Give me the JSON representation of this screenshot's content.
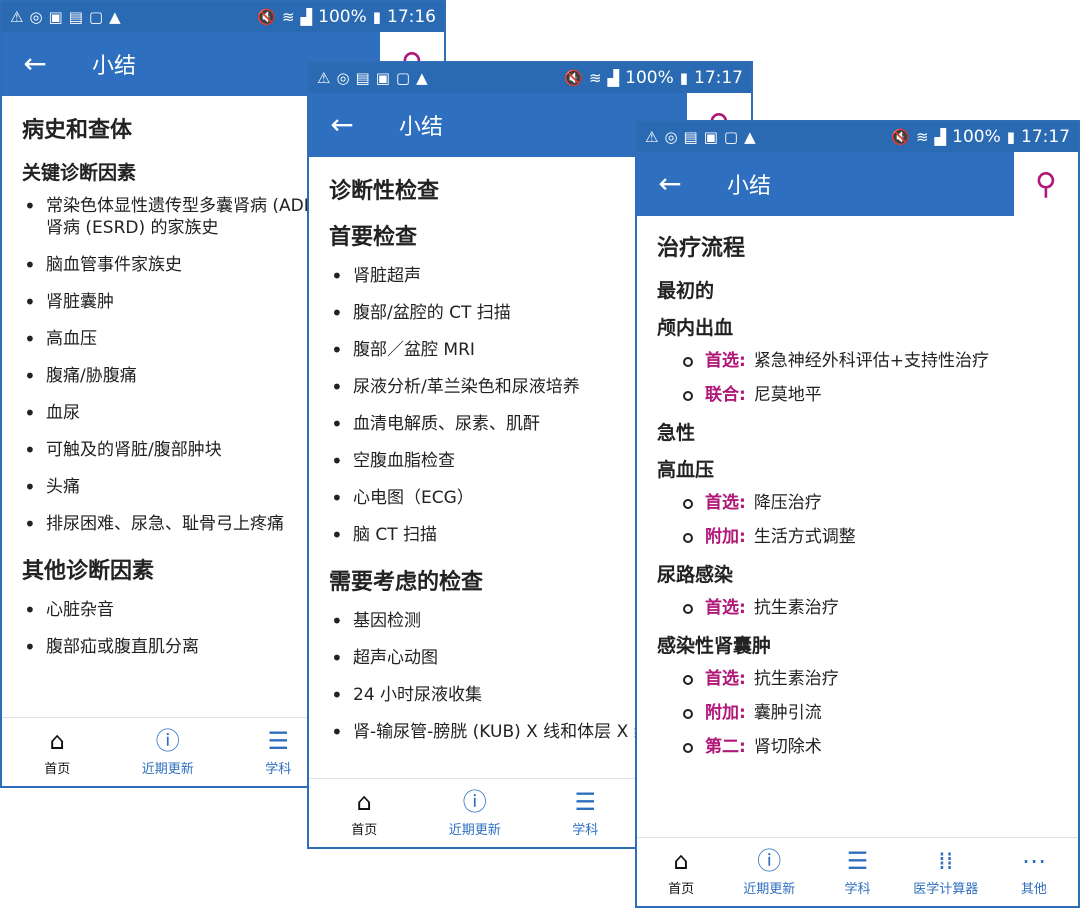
{
  "status": {
    "time1": "17:16",
    "time2": "17:17",
    "time3": "17:17",
    "battery": "100%"
  },
  "appbar": {
    "title": "小结"
  },
  "nav": [
    {
      "label": "首页"
    },
    {
      "label": "近期更新"
    },
    {
      "label": "学科"
    },
    {
      "label": "医学计算器"
    },
    {
      "label": "其他"
    }
  ],
  "screen1": {
    "heading": "病史和查体",
    "sub1": "关键诊断因素",
    "items1": [
      "常染色体显性遗传型多囊肾病 (ADPKD) 或终末期肾病 (ESRD) 的家族史",
      "脑血管事件家族史",
      "肾脏囊肿",
      "高血压",
      "腹痛/胁腹痛",
      "血尿",
      "可触及的肾脏/腹部肿块",
      "头痛",
      "排尿困难、尿急、耻骨弓上疼痛"
    ],
    "sub2": "其他诊断因素",
    "items2": [
      "心脏杂音",
      "腹部疝或腹直肌分离"
    ]
  },
  "screen2": {
    "heading": "诊断性检查",
    "sub1": "首要检查",
    "items1": [
      "肾脏超声",
      "腹部/盆腔的 CT 扫描",
      "腹部／盆腔 MRI",
      "尿液分析/革兰染色和尿液培养",
      "血清电解质、尿素、肌酐",
      "空腹血脂检查",
      "心电图（ECG）",
      "脑 CT 扫描"
    ],
    "sub2": "需要考虑的检查",
    "items2": [
      "基因检测",
      "超声心动图",
      "24 小时尿液收集",
      "肾-输尿管-膀胱 (KUB) X 线和体层 X 线摄影"
    ]
  },
  "screen3": {
    "heading": "治疗流程",
    "s1": "最初的",
    "s1a": "颅内出血",
    "s1a_items": [
      {
        "tag": "首选:",
        "text": "紧急神经外科评估+支持性治疗"
      },
      {
        "tag": "联合:",
        "text": "尼莫地平"
      }
    ],
    "s2": "急性",
    "s2a": "高血压",
    "s2a_items": [
      {
        "tag": "首选:",
        "text": "降压治疗"
      },
      {
        "tag": "附加:",
        "text": "生活方式调整"
      }
    ],
    "s2b": "尿路感染",
    "s2b_items": [
      {
        "tag": "首选:",
        "text": "抗生素治疗"
      }
    ],
    "s2c": "感染性肾囊肿",
    "s2c_items": [
      {
        "tag": "首选:",
        "text": "抗生素治疗"
      },
      {
        "tag": "附加:",
        "text": "囊肿引流"
      },
      {
        "tag": "第二:",
        "text": "肾切除术"
      }
    ]
  }
}
